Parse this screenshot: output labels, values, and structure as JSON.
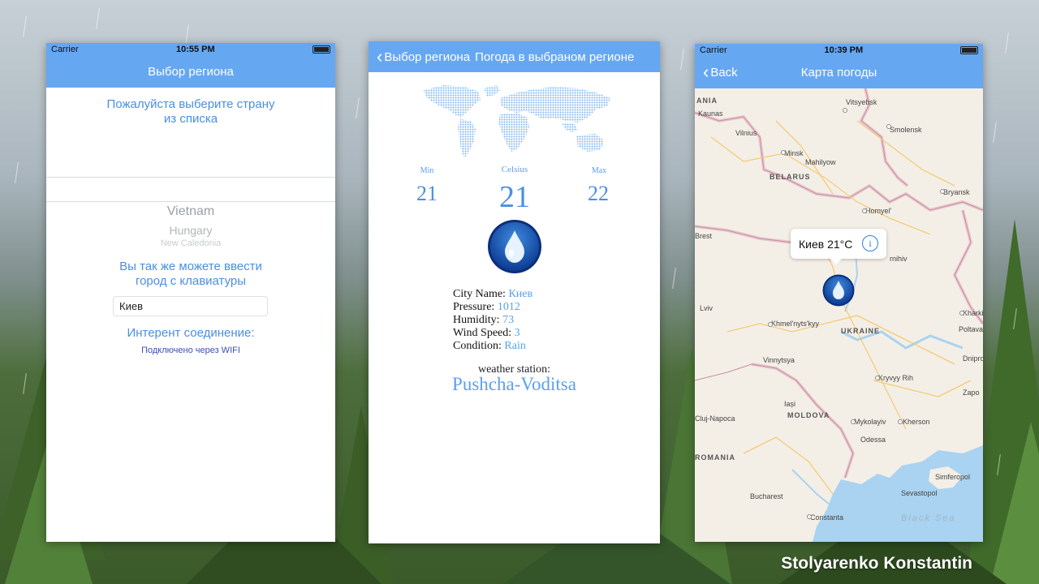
{
  "author": "Stolyarenko Konstantin",
  "screen1": {
    "status": {
      "carrier": "Carrier",
      "time": "10:55 PM"
    },
    "nav_title": "Выбор региона",
    "prompt_line1": "Пожалуйста выберите страну",
    "prompt_line2": "из списка",
    "picker_items": [
      "Vietnam",
      "Hungary",
      "New Caledonia"
    ],
    "keyboard_label_line1": "Вы так же можете ввести",
    "keyboard_label_line2": "город с клавиатуры",
    "city_input_value": "Киев",
    "connection_label": "Интерент соединение:",
    "connection_status": "Подключено через WIFI"
  },
  "screen2": {
    "back_label": "Выбор региона",
    "nav_title": "Погода в выбраном регионе",
    "min_label": "Min",
    "min_value": "21",
    "celsius_label": "Celsius",
    "current_value": "21",
    "max_label": "Max",
    "max_value": "22",
    "fields": [
      {
        "label": "City Name:",
        "value": "Киев"
      },
      {
        "label": "Pressure:",
        "value": "1012"
      },
      {
        "label": "Humidity:",
        "value": "73"
      },
      {
        "label": "Wind Speed:",
        "value": "3"
      },
      {
        "label": "Condition:",
        "value": "Rain"
      }
    ],
    "station_label": "weather station:",
    "station_name": "Pushcha-Voditsa"
  },
  "screen3": {
    "status": {
      "carrier": "Carrier",
      "time": "10:39 PM"
    },
    "back_label": "Back",
    "nav_title": "Карта погоды",
    "callout_text": "Киев 21°C",
    "map_labels": {
      "lithuania": "ANIA",
      "kaunas": "Kaunas",
      "vitsyebsk": "Vitsyebsk",
      "vilnius": "Vilnius",
      "smolensk": "Smolensk",
      "minsk": "Minsk",
      "mahilyow": "Mahilyow",
      "belarus": "BELARUS",
      "bryansk": "Bryansk",
      "homyel": "Homyel'",
      "brest": "Brest",
      "chernihiv": "rnihiv",
      "lviv": "Lviv",
      "khmelnytskyy": "Khmel'nyts'kyy",
      "ukraine": "UKRAINE",
      "kharkiv": "Kharkiv",
      "poltava": "Poltava",
      "vinnytsya": "Vinnytsya",
      "dnipro": "Dnipro",
      "kryvyy_rih": "Kryvyy Rih",
      "zaporizhzhia": "Zapo",
      "iasi": "Iași",
      "cluj": "Cluj-Napoca",
      "moldova": "MOLDOVA",
      "mykolayiv": "Mykolayiv",
      "kherson": "Kherson",
      "odessa": "Odessa",
      "romania": "ROMANIA",
      "simferopol": "Simferopol",
      "sevastopol": "Sevastopol",
      "bucharest": "Bucharest",
      "constanta": "Constanta",
      "black_sea": "Black Sea"
    }
  },
  "colors": {
    "navbar": "#66a7f2",
    "accent": "#4a8fe0",
    "map_bg": "#f4efe6",
    "sea": "#a9d3f0"
  }
}
